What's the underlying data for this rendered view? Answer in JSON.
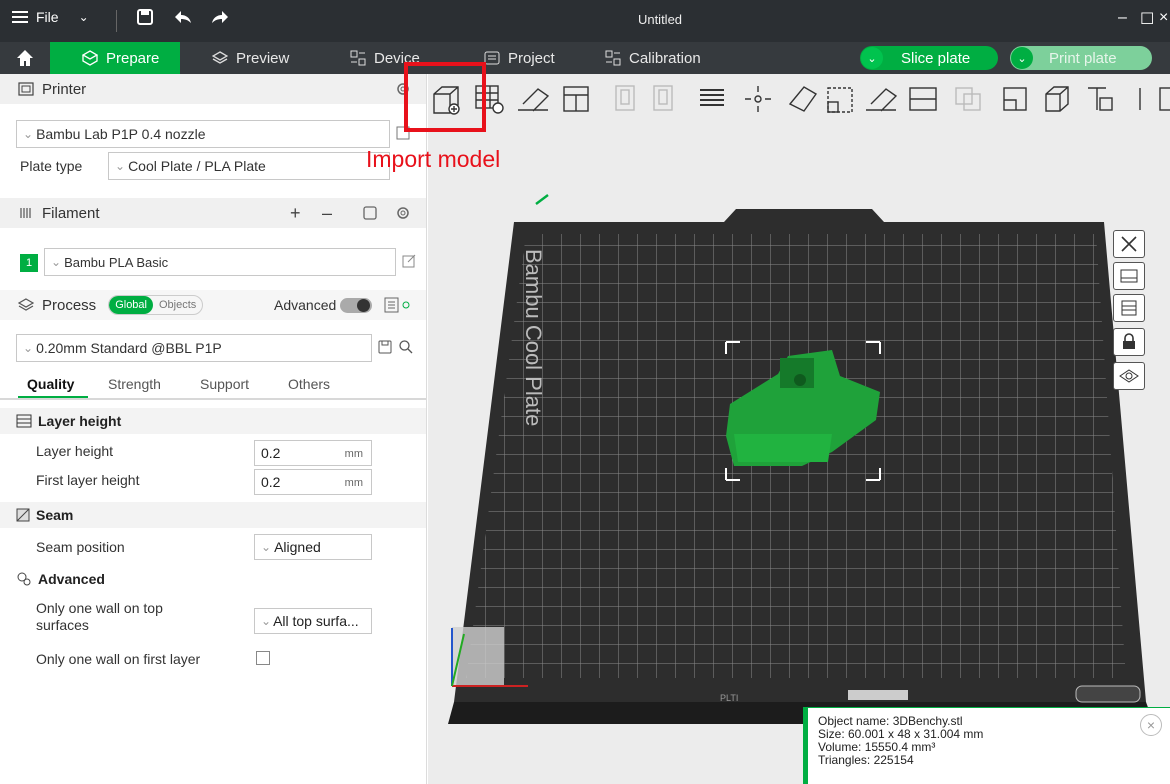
{
  "titlebar": {
    "file_label": "File",
    "title": "Untitled",
    "minimize": "–",
    "maximize": "☐",
    "close": "×"
  },
  "tabs": {
    "prepare": "Prepare",
    "preview": "Preview",
    "device": "Device",
    "project": "Project",
    "calibration": "Calibration",
    "slice_plate": "Slice plate",
    "print_plate": "Print plate"
  },
  "printer": {
    "section_label": "Printer",
    "selected": "Bambu Lab P1P 0.4 nozzle",
    "plate_type_label": "Plate type",
    "plate_type_value": "Cool Plate / PLA Plate"
  },
  "filament": {
    "section_label": "Filament",
    "add": "+",
    "remove": "–",
    "slot_number": "1",
    "selected": "Bambu PLA Basic"
  },
  "process": {
    "section_label": "Process",
    "toggle_global": "Global",
    "toggle_objects": "Objects",
    "advanced_label": "Advanced",
    "preset": "0.20mm Standard @BBL P1P",
    "tabs": [
      "Quality",
      "Strength",
      "Support",
      "Others"
    ],
    "active_tab": "Quality"
  },
  "settings": {
    "layer_height_group": "Layer height",
    "layer_height_label": "Layer height",
    "layer_height_value": "0.2",
    "first_layer_height_label": "First layer height",
    "first_layer_height_value": "0.2",
    "unit_mm": "mm",
    "seam_group": "Seam",
    "seam_position_label": "Seam position",
    "seam_position_value": "Aligned",
    "advanced_group": "Advanced",
    "one_wall_top_label_line1": "Only one wall on top",
    "one_wall_top_label_line2": "surfaces",
    "one_wall_top_value": "All top surfa...",
    "one_wall_first_label": "Only one wall on first layer",
    "one_wall_first_checked": false
  },
  "viewport": {
    "annotation": "Import model",
    "plate_label": "Bambu Cool Plate",
    "plate_bottom_text": "PLTI",
    "model_color": "#1fa23a"
  },
  "object_info": {
    "name": "Object name: 3DBenchy.stl",
    "size": "Size: 60.001 x 48 x 31.004 mm",
    "volume": "Volume: 15550.4 mm³",
    "triangles": "Triangles: 225154"
  },
  "colors": {
    "accent": "#00ae42",
    "annotation_red": "#e8111b",
    "titlebar": "#2b2f33",
    "tabbar": "#363a3e"
  }
}
